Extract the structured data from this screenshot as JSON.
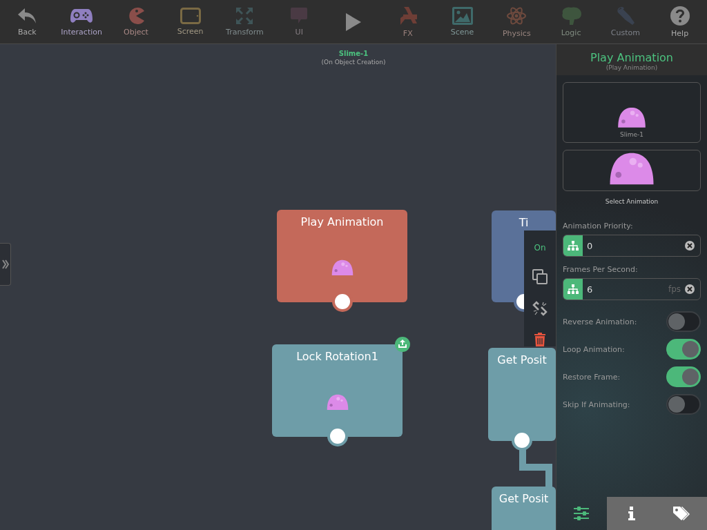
{
  "toolbar": [
    {
      "kind": "back",
      "label": "Back",
      "color": "#8a8a8a"
    },
    {
      "kind": "interaction",
      "label": "Interaction",
      "color": "#8f7fc0"
    },
    {
      "kind": "object",
      "label": "Object",
      "color": "#8a4e4a"
    },
    {
      "kind": "screen",
      "label": "Screen",
      "color": "#7a6a44"
    },
    {
      "kind": "transform",
      "label": "Transform",
      "color": "#3f5558"
    },
    {
      "kind": "ui",
      "label": "UI",
      "color": "#4a3a44"
    },
    {
      "kind": "play"
    },
    {
      "kind": "fx",
      "label": "FX",
      "color": "#6e3e36"
    },
    {
      "kind": "scene",
      "label": "Scene",
      "color": "#3f6a6a"
    },
    {
      "kind": "physics",
      "label": "Physics",
      "color": "#6e4a3e"
    },
    {
      "kind": "logic",
      "label": "Logic",
      "color": "#3e553e"
    },
    {
      "kind": "custom",
      "label": "Custom",
      "color": "#3a4250"
    },
    {
      "kind": "help",
      "label": "Help",
      "color": "#8a8a8a"
    }
  ],
  "canvas": {
    "object_name": "Slime-1",
    "event": "(On Object Creation)",
    "nodes": [
      {
        "title": "Play Animation",
        "color": "#c4695a",
        "sprite": true,
        "export_badge": false
      },
      {
        "title": "Lock Rotation1",
        "color": "#6e9da8",
        "sprite": true,
        "export_badge": true
      },
      {
        "title": "Ti",
        "color": "#5a7199",
        "sprite": false,
        "export_badge": false
      },
      {
        "title": "Get Posit",
        "color": "#6e9da8",
        "sprite": false,
        "export_badge": false
      },
      {
        "title": "Get Posit",
        "color": "#6e9da8",
        "sprite": false,
        "export_badge": false
      }
    ],
    "context_menu": {
      "label": "On"
    }
  },
  "panel": {
    "title": "Play Animation",
    "subtitle": "(Play Animation)",
    "sprite_label": "Slime-1",
    "animation_label": "Select Animation",
    "fields": [
      {
        "label": "Animation Priority:",
        "value": "0"
      },
      {
        "label": "Frames Per Second:",
        "value": "6",
        "unit": "fps"
      }
    ],
    "toggles": [
      {
        "label": "Reverse Animation:",
        "on": false
      },
      {
        "label": "Loop Animation:",
        "on": true
      },
      {
        "label": "Restore Frame:",
        "on": true
      },
      {
        "label": "Skip If Animating:",
        "on": false
      }
    ],
    "tabs": [
      {
        "kind": "settings",
        "selected": true
      },
      {
        "kind": "info",
        "selected": false
      },
      {
        "kind": "tags",
        "selected": false
      }
    ]
  }
}
